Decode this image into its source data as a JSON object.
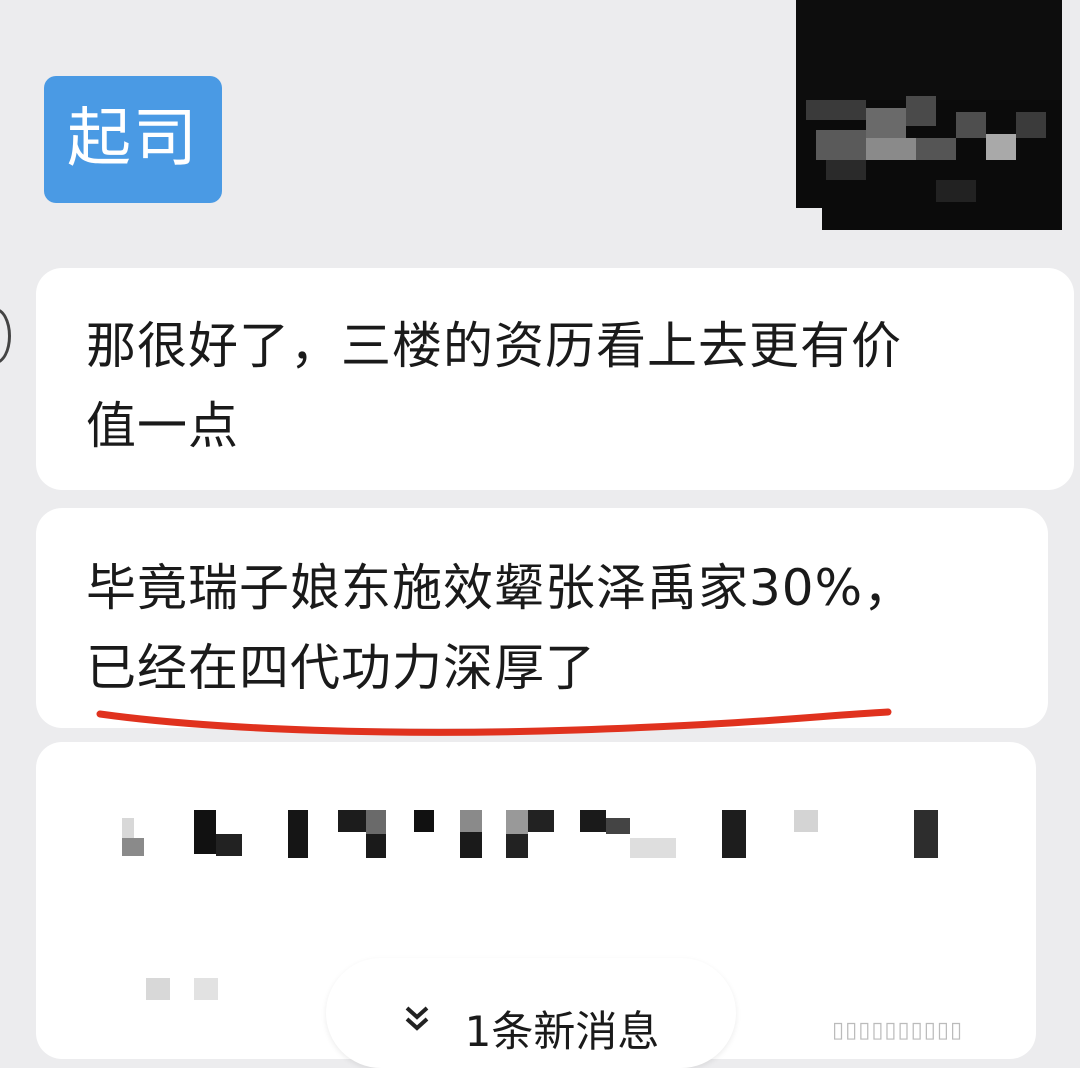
{
  "sender_tag": "起司",
  "messages": [
    {
      "text": "那很好了，三楼的资历看上去更有价\n值一点"
    },
    {
      "text": "毕竟瑞子娘东施效颦张泽禹家30%，\n已经在四代功力深厚了"
    }
  ],
  "new_message_pill": {
    "icon": "chevron-double-down-icon",
    "label": "1条新消息"
  },
  "colors": {
    "background": "#ececee",
    "tag": "#4a9ae4",
    "bubble": "#ffffff",
    "underline": "#e0321e"
  }
}
